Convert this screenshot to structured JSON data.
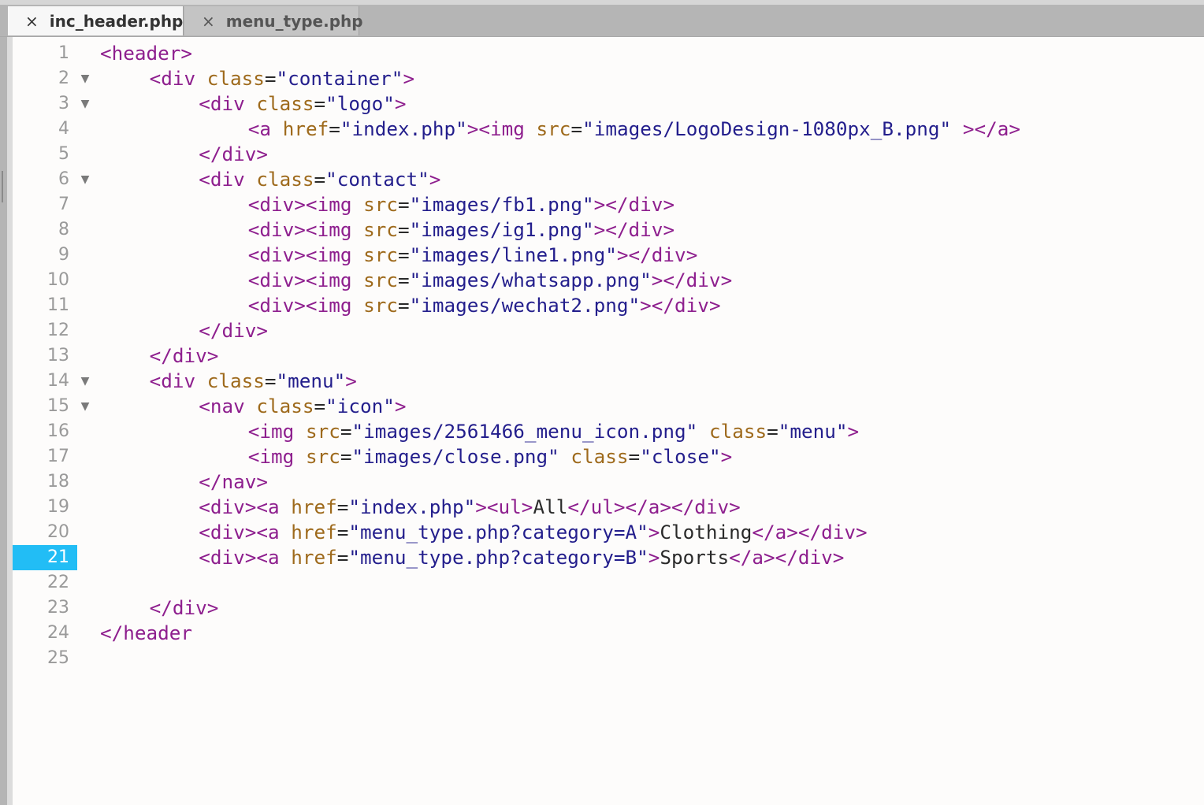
{
  "tabs": [
    {
      "close_icon": "×",
      "label": "inc_header.php",
      "active": true
    },
    {
      "close_icon": "×",
      "label": "menu_type.php",
      "active": false
    }
  ],
  "editor": {
    "current_line": 21,
    "lines": [
      {
        "n": "1",
        "fold": false,
        "indent": 0,
        "tokens": [
          {
            "t": "tag",
            "v": "<header>"
          }
        ]
      },
      {
        "n": "2",
        "fold": true,
        "indent": 1,
        "tokens": [
          {
            "t": "tag",
            "v": "<div "
          },
          {
            "t": "attr",
            "v": "class"
          },
          {
            "t": "op",
            "v": "="
          },
          {
            "t": "str",
            "v": "\"container\""
          },
          {
            "t": "tag",
            "v": ">"
          }
        ]
      },
      {
        "n": "3",
        "fold": true,
        "indent": 2,
        "tokens": [
          {
            "t": "tag",
            "v": "<div "
          },
          {
            "t": "attr",
            "v": "class"
          },
          {
            "t": "op",
            "v": "="
          },
          {
            "t": "str",
            "v": "\"logo\""
          },
          {
            "t": "tag",
            "v": ">"
          }
        ]
      },
      {
        "n": "4",
        "fold": false,
        "indent": 3,
        "tokens": [
          {
            "t": "tag",
            "v": "<a "
          },
          {
            "t": "attr",
            "v": "href"
          },
          {
            "t": "op",
            "v": "="
          },
          {
            "t": "str",
            "v": "\"index.php\""
          },
          {
            "t": "tag",
            "v": "><img "
          },
          {
            "t": "attr",
            "v": "src"
          },
          {
            "t": "op",
            "v": "="
          },
          {
            "t": "str",
            "v": "\"images/LogoDesign-1080px_B.png\" "
          },
          {
            "t": "tag",
            "v": "></a>"
          }
        ]
      },
      {
        "n": "5",
        "fold": false,
        "indent": 2,
        "tokens": [
          {
            "t": "tag",
            "v": "</div>"
          }
        ]
      },
      {
        "n": "6",
        "fold": true,
        "indent": 2,
        "tokens": [
          {
            "t": "tag",
            "v": "<div "
          },
          {
            "t": "attr",
            "v": "class"
          },
          {
            "t": "op",
            "v": "="
          },
          {
            "t": "str",
            "v": "\"contact\""
          },
          {
            "t": "tag",
            "v": ">"
          }
        ]
      },
      {
        "n": "7",
        "fold": false,
        "indent": 3,
        "tokens": [
          {
            "t": "tag",
            "v": "<div><img "
          },
          {
            "t": "attr",
            "v": "src"
          },
          {
            "t": "op",
            "v": "="
          },
          {
            "t": "str",
            "v": "\"images/fb1.png\""
          },
          {
            "t": "tag",
            "v": "></div>"
          }
        ]
      },
      {
        "n": "8",
        "fold": false,
        "indent": 3,
        "tokens": [
          {
            "t": "tag",
            "v": "<div><img "
          },
          {
            "t": "attr",
            "v": "src"
          },
          {
            "t": "op",
            "v": "="
          },
          {
            "t": "str",
            "v": "\"images/ig1.png\""
          },
          {
            "t": "tag",
            "v": "></div>"
          }
        ]
      },
      {
        "n": "9",
        "fold": false,
        "indent": 3,
        "tokens": [
          {
            "t": "tag",
            "v": "<div><img "
          },
          {
            "t": "attr",
            "v": "src"
          },
          {
            "t": "op",
            "v": "="
          },
          {
            "t": "str",
            "v": "\"images/line1.png\""
          },
          {
            "t": "tag",
            "v": "></div>"
          }
        ]
      },
      {
        "n": "10",
        "fold": false,
        "indent": 3,
        "tokens": [
          {
            "t": "tag",
            "v": "<div><img "
          },
          {
            "t": "attr",
            "v": "src"
          },
          {
            "t": "op",
            "v": "="
          },
          {
            "t": "str",
            "v": "\"images/whatsapp.png\""
          },
          {
            "t": "tag",
            "v": "></div>"
          }
        ]
      },
      {
        "n": "11",
        "fold": false,
        "indent": 3,
        "tokens": [
          {
            "t": "tag",
            "v": "<div><img "
          },
          {
            "t": "attr",
            "v": "src"
          },
          {
            "t": "op",
            "v": "="
          },
          {
            "t": "str",
            "v": "\"images/wechat2.png\""
          },
          {
            "t": "tag",
            "v": "></div>"
          }
        ]
      },
      {
        "n": "12",
        "fold": false,
        "indent": 2,
        "tokens": [
          {
            "t": "tag",
            "v": "</div>"
          }
        ]
      },
      {
        "n": "13",
        "fold": false,
        "indent": 1,
        "tokens": [
          {
            "t": "tag",
            "v": "</div>"
          }
        ]
      },
      {
        "n": "14",
        "fold": true,
        "indent": 1,
        "tokens": [
          {
            "t": "tag",
            "v": "<div "
          },
          {
            "t": "attr",
            "v": "class"
          },
          {
            "t": "op",
            "v": "="
          },
          {
            "t": "str",
            "v": "\"menu\""
          },
          {
            "t": "tag",
            "v": ">"
          }
        ]
      },
      {
        "n": "15",
        "fold": true,
        "indent": 2,
        "tokens": [
          {
            "t": "tag",
            "v": "<nav "
          },
          {
            "t": "attr",
            "v": "class"
          },
          {
            "t": "op",
            "v": "="
          },
          {
            "t": "str",
            "v": "\"icon\""
          },
          {
            "t": "tag",
            "v": ">"
          }
        ]
      },
      {
        "n": "16",
        "fold": false,
        "indent": 3,
        "tokens": [
          {
            "t": "tag",
            "v": "<img "
          },
          {
            "t": "attr",
            "v": "src"
          },
          {
            "t": "op",
            "v": "="
          },
          {
            "t": "str",
            "v": "\"images/2561466_menu_icon.png\" "
          },
          {
            "t": "attr",
            "v": "class"
          },
          {
            "t": "op",
            "v": "="
          },
          {
            "t": "str",
            "v": "\"menu\""
          },
          {
            "t": "tag",
            "v": ">"
          }
        ]
      },
      {
        "n": "17",
        "fold": false,
        "indent": 3,
        "tokens": [
          {
            "t": "tag",
            "v": "<img "
          },
          {
            "t": "attr",
            "v": "src"
          },
          {
            "t": "op",
            "v": "="
          },
          {
            "t": "str",
            "v": "\"images/close.png\" "
          },
          {
            "t": "attr",
            "v": "class"
          },
          {
            "t": "op",
            "v": "="
          },
          {
            "t": "str",
            "v": "\"close\""
          },
          {
            "t": "tag",
            "v": ">"
          }
        ]
      },
      {
        "n": "18",
        "fold": false,
        "indent": 2,
        "tokens": [
          {
            "t": "tag",
            "v": "</nav>"
          }
        ]
      },
      {
        "n": "19",
        "fold": false,
        "indent": 2,
        "tokens": [
          {
            "t": "tag",
            "v": "<div><a "
          },
          {
            "t": "attr",
            "v": "href"
          },
          {
            "t": "op",
            "v": "="
          },
          {
            "t": "str",
            "v": "\"index.php\""
          },
          {
            "t": "tag",
            "v": "><ul>"
          },
          {
            "t": "text",
            "v": "All"
          },
          {
            "t": "tag",
            "v": "</ul></a></div>"
          }
        ]
      },
      {
        "n": "20",
        "fold": false,
        "indent": 2,
        "tokens": [
          {
            "t": "tag",
            "v": "<div><a "
          },
          {
            "t": "attr",
            "v": "href"
          },
          {
            "t": "op",
            "v": "="
          },
          {
            "t": "str",
            "v": "\"menu_type.php?category=A\""
          },
          {
            "t": "tag",
            "v": ">"
          },
          {
            "t": "text",
            "v": "Clothing"
          },
          {
            "t": "tag",
            "v": "</a></div>"
          }
        ]
      },
      {
        "n": "21",
        "fold": false,
        "indent": 2,
        "tokens": [
          {
            "t": "tag",
            "v": "<div><a "
          },
          {
            "t": "attr",
            "v": "href"
          },
          {
            "t": "op",
            "v": "="
          },
          {
            "t": "str",
            "v": "\"menu_type.php?category=B\""
          },
          {
            "t": "tag",
            "v": ">"
          },
          {
            "t": "text",
            "v": "Sports"
          },
          {
            "t": "tag",
            "v": "</a></div>"
          }
        ]
      },
      {
        "n": "22",
        "fold": false,
        "indent": 0,
        "tokens": []
      },
      {
        "n": "23",
        "fold": false,
        "indent": 1,
        "tokens": [
          {
            "t": "tag",
            "v": "</div>"
          }
        ]
      },
      {
        "n": "24",
        "fold": false,
        "indent": 0,
        "tokens": [
          {
            "t": "tag",
            "v": "</header"
          }
        ]
      },
      {
        "n": "25",
        "fold": false,
        "indent": 0,
        "tokens": []
      }
    ]
  }
}
